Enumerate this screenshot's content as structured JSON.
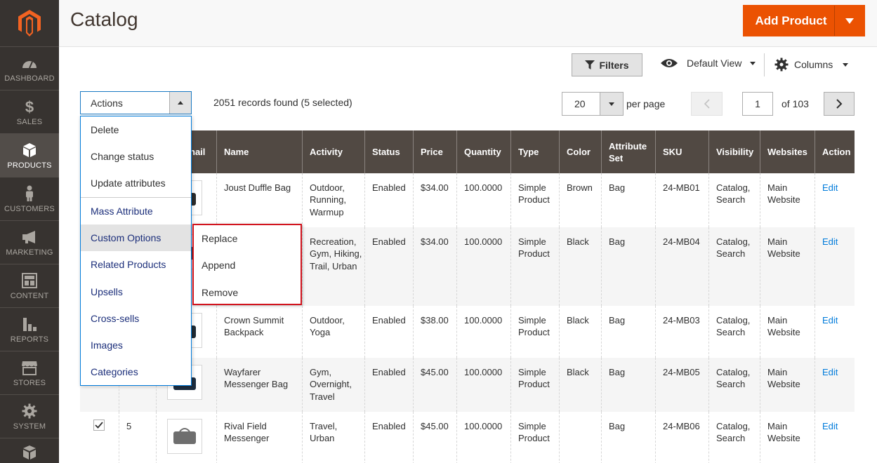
{
  "sidebar": {
    "items": [
      {
        "label": "DASHBOARD",
        "icon": "dashboard-icon"
      },
      {
        "label": "SALES",
        "icon": "dollar-icon"
      },
      {
        "label": "PRODUCTS",
        "icon": "cube-icon"
      },
      {
        "label": "CUSTOMERS",
        "icon": "person-icon"
      },
      {
        "label": "MARKETING",
        "icon": "megaphone-icon"
      },
      {
        "label": "CONTENT",
        "icon": "layout-icon"
      },
      {
        "label": "REPORTS",
        "icon": "bar-chart-icon"
      },
      {
        "label": "STORES",
        "icon": "storefront-icon"
      },
      {
        "label": "SYSTEM",
        "icon": "gear-icon"
      }
    ],
    "active": "PRODUCTS"
  },
  "header": {
    "title": "Catalog",
    "add_product": "Add Product"
  },
  "toolbar": {
    "filters": "Filters",
    "view": "Default View",
    "columns": "Columns"
  },
  "actions": {
    "label": "Actions",
    "records": "2051 records found (5 selected)",
    "menu": [
      "Delete",
      "Change status",
      "Update attributes",
      "Mass Attribute",
      "Custom Options",
      "Related Products",
      "Upsells",
      "Cross-sells",
      "Images",
      "Categories"
    ],
    "submenu": [
      "Replace",
      "Append",
      "Remove"
    ]
  },
  "pager": {
    "per_page": "20",
    "per_page_label": "per page",
    "current_page": "1",
    "of_label": "of 103"
  },
  "grid": {
    "headers": {
      "thumbnail": "nail",
      "name": "Name",
      "activity": "Activity",
      "status": "Status",
      "price": "Price",
      "quantity": "Quantity",
      "type": "Type",
      "color": "Color",
      "attribute_set": "Attribute Set",
      "sku": "SKU",
      "visibility": "Visibility",
      "websites": "Websites",
      "action": "Action"
    },
    "rows": [
      {
        "id": "",
        "name": "Joust Duffle Bag",
        "activity": "Outdoor, Running, Warmup",
        "status": "Enabled",
        "price": "$34.00",
        "quantity": "100.0000",
        "type": "Simple Product",
        "color": "Brown",
        "attribute_set": "Bag",
        "sku": "24-MB01",
        "visibility": "Catalog, Search",
        "websites": "Main Website",
        "action": "Edit"
      },
      {
        "id": "",
        "name": "",
        "activity": "Recreation, Gym, Hiking, Trail, Urban",
        "status": "Enabled",
        "price": "$34.00",
        "quantity": "100.0000",
        "type": "Simple Product",
        "color": "Black",
        "attribute_set": "Bag",
        "sku": "24-MB04",
        "visibility": "Catalog, Search",
        "websites": "Main Website",
        "action": "Edit"
      },
      {
        "id": "",
        "name": "Crown Summit Backpack",
        "activity": "Outdoor, Yoga",
        "status": "Enabled",
        "price": "$38.00",
        "quantity": "100.0000",
        "type": "Simple Product",
        "color": "Black",
        "attribute_set": "Bag",
        "sku": "24-MB03",
        "visibility": "Catalog, Search",
        "websites": "Main Website",
        "action": "Edit"
      },
      {
        "id": "",
        "name": "Wayfarer Messenger Bag",
        "activity": "Gym, Overnight, Travel",
        "status": "Enabled",
        "price": "$45.00",
        "quantity": "100.0000",
        "type": "Simple Product",
        "color": "Black",
        "attribute_set": "Bag",
        "sku": "24-MB05",
        "visibility": "Catalog, Search",
        "websites": "Main Website",
        "action": "Edit"
      },
      {
        "id": "5",
        "name": "Rival Field Messenger",
        "activity": "Travel, Urban",
        "status": "Enabled",
        "price": "$45.00",
        "quantity": "100.0000",
        "type": "Simple Product",
        "color": "",
        "attribute_set": "Bag",
        "sku": "24-MB06",
        "visibility": "Catalog, Search",
        "websites": "Main Website",
        "action": "Edit"
      }
    ]
  },
  "colors": {
    "accent": "#eb5202",
    "sidebar": "#373330",
    "grid_header": "#514943",
    "link": "#007bdb",
    "highlight_border": "#d2141e"
  }
}
